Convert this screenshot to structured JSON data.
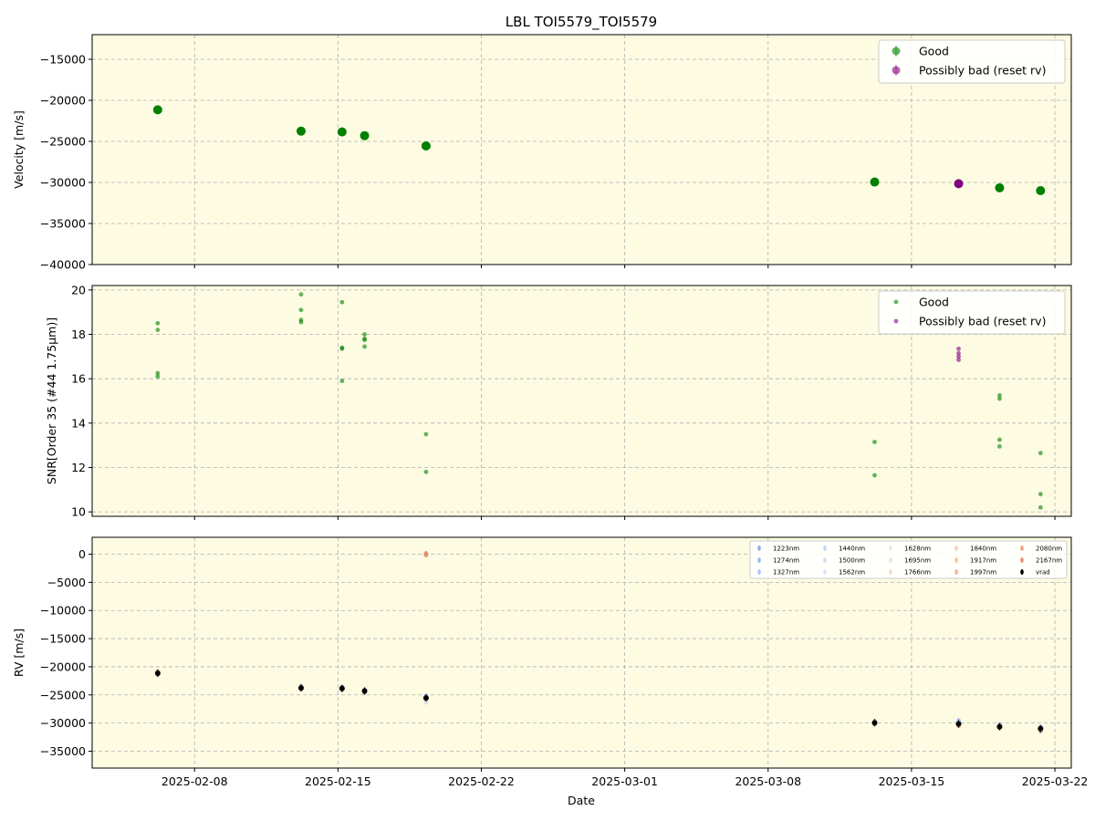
{
  "title": "LBL TOI5579_TOI5579",
  "colors": {
    "panel_bg": "#fdfbe2",
    "good": "#008000",
    "bad": "#800080",
    "vrad": "#000000"
  },
  "chart_data": [
    {
      "type": "scatter",
      "ylabel": "Velocity [m/s]",
      "ylim": [
        -40000,
        -12000
      ],
      "yticks": [
        -40000,
        -35000,
        -30000,
        -25000,
        -20000,
        -15000
      ],
      "xlim": [
        "2025-02-03",
        "2025-03-22.8"
      ],
      "xticks": [
        "2025-02-08",
        "2025-02-15",
        "2025-02-22",
        "2025-03-01",
        "2025-03-08",
        "2025-03-15",
        "2025-03-22"
      ],
      "grid": true,
      "legend": "top-right",
      "series": [
        {
          "name": "Good",
          "points": [
            {
              "x": "2025-02-06.2",
              "y": -21150
            },
            {
              "x": "2025-02-13.2",
              "y": -23750
            },
            {
              "x": "2025-02-15.2",
              "y": -23850
            },
            {
              "x": "2025-02-16.3",
              "y": -24300
            },
            {
              "x": "2025-02-19.3",
              "y": -25550
            },
            {
              "x": "2025-03-13.2",
              "y": -29950
            },
            {
              "x": "2025-03-19.3",
              "y": -30650
            },
            {
              "x": "2025-03-21.3",
              "y": -31000
            }
          ]
        },
        {
          "name": "Possibly bad (reset rv)",
          "points": [
            {
              "x": "2025-03-17.3",
              "y": -30150
            }
          ]
        }
      ]
    },
    {
      "type": "scatter",
      "ylabel": "SNR[Order 35 (#44 1.75μm)]",
      "ylim": [
        9.8,
        20.2
      ],
      "yticks": [
        10,
        12,
        14,
        16,
        18,
        20
      ],
      "xlim": [
        "2025-02-03",
        "2025-03-22.8"
      ],
      "grid": true,
      "legend": "top-right",
      "series": [
        {
          "name": "Good",
          "points": [
            {
              "x": "2025-02-06.2",
              "y": 18.5
            },
            {
              "x": "2025-02-06.2",
              "y": 18.2
            },
            {
              "x": "2025-02-06.2",
              "y": 16.25
            },
            {
              "x": "2025-02-06.2",
              "y": 16.1
            },
            {
              "x": "2025-02-13.2",
              "y": 19.8
            },
            {
              "x": "2025-02-13.2",
              "y": 19.1
            },
            {
              "x": "2025-02-13.2",
              "y": 18.65
            },
            {
              "x": "2025-02-13.2",
              "y": 18.55
            },
            {
              "x": "2025-02-15.2",
              "y": 19.45
            },
            {
              "x": "2025-02-15.2",
              "y": 17.4
            },
            {
              "x": "2025-02-15.2",
              "y": 17.35
            },
            {
              "x": "2025-02-15.2",
              "y": 15.9
            },
            {
              "x": "2025-02-16.3",
              "y": 18.0
            },
            {
              "x": "2025-02-16.3",
              "y": 17.8
            },
            {
              "x": "2025-02-16.3",
              "y": 17.75
            },
            {
              "x": "2025-02-16.3",
              "y": 17.45
            },
            {
              "x": "2025-02-19.3",
              "y": 13.5
            },
            {
              "x": "2025-02-19.3",
              "y": 11.8
            },
            {
              "x": "2025-03-13.2",
              "y": 13.15
            },
            {
              "x": "2025-03-13.2",
              "y": 11.65
            },
            {
              "x": "2025-03-19.3",
              "y": 15.25
            },
            {
              "x": "2025-03-19.3",
              "y": 15.1
            },
            {
              "x": "2025-03-19.3",
              "y": 13.25
            },
            {
              "x": "2025-03-19.3",
              "y": 12.95
            },
            {
              "x": "2025-03-21.3",
              "y": 12.65
            },
            {
              "x": "2025-03-21.3",
              "y": 10.8
            },
            {
              "x": "2025-03-21.3",
              "y": 10.2
            }
          ]
        },
        {
          "name": "Possibly bad (reset rv)",
          "points": [
            {
              "x": "2025-03-17.3",
              "y": 17.35
            },
            {
              "x": "2025-03-17.3",
              "y": 17.15
            },
            {
              "x": "2025-03-17.3",
              "y": 17.0
            },
            {
              "x": "2025-03-17.3",
              "y": 16.85
            }
          ]
        }
      ]
    },
    {
      "type": "scatter",
      "ylabel": "RV [m/s]",
      "xlabel": "Date",
      "ylim": [
        -38000,
        3000
      ],
      "yticks": [
        -35000,
        -30000,
        -25000,
        -20000,
        -15000,
        -10000,
        -5000,
        0
      ],
      "xlim": [
        "2025-02-03",
        "2025-03-22.8"
      ],
      "xticks": [
        "2025-02-08",
        "2025-02-15",
        "2025-02-22",
        "2025-03-01",
        "2025-03-08",
        "2025-03-15",
        "2025-03-22"
      ],
      "grid": true,
      "legend": "top-right",
      "legend_series": [
        {
          "name": "1223nm",
          "color": "#6f8ff0"
        },
        {
          "name": "1274nm",
          "color": "#7f9ff5"
        },
        {
          "name": "1327nm",
          "color": "#93b2f8"
        },
        {
          "name": "1440nm",
          "color": "#a9c4fb"
        },
        {
          "name": "1500nm",
          "color": "#bdd1f8"
        },
        {
          "name": "1562nm",
          "color": "#cfdaf2"
        },
        {
          "name": "1628nm",
          "color": "#dedde0"
        },
        {
          "name": "1695nm",
          "color": "#e8d6cc"
        },
        {
          "name": "1766nm",
          "color": "#f0cdb9"
        },
        {
          "name": "1840nm",
          "color": "#f5c0a3"
        },
        {
          "name": "1917nm",
          "color": "#f5ae8a"
        },
        {
          "name": "1997nm",
          "color": "#f19a74"
        },
        {
          "name": "2080nm",
          "color": "#e8845f"
        },
        {
          "name": "2167nm",
          "color": "#dc6a4c"
        },
        {
          "name": "vrad",
          "color": "#000000"
        }
      ],
      "colored_points": [
        {
          "x": "2025-02-06.2",
          "ys": [
            -21000,
            -21300,
            -20900,
            -21200
          ]
        },
        {
          "x": "2025-02-13.2",
          "ys": [
            -23600,
            -23900,
            -23700,
            -23800
          ]
        },
        {
          "x": "2025-02-15.2",
          "ys": [
            -23700,
            -24000,
            -23800,
            -23900
          ]
        },
        {
          "x": "2025-02-16.3",
          "ys": [
            -24200,
            -24500,
            -24300,
            -24400
          ]
        },
        {
          "x": "2025-02-19.3",
          "ys": [
            -25300,
            -26200,
            -25700,
            0
          ]
        },
        {
          "x": "2025-03-13.2",
          "ys": [
            -29800,
            -30100,
            -29900,
            -30000
          ]
        },
        {
          "x": "2025-03-17.3",
          "ys": [
            -29700,
            -30400,
            -30100,
            -30300
          ]
        },
        {
          "x": "2025-03-19.3",
          "ys": [
            -30400,
            -30800,
            -30600,
            -30700
          ]
        },
        {
          "x": "2025-03-21.3",
          "ys": [
            -30800,
            -31400,
            -31000,
            -31200
          ]
        }
      ],
      "vrad_points": [
        {
          "x": "2025-02-06.2",
          "y": -21150
        },
        {
          "x": "2025-02-13.2",
          "y": -23750
        },
        {
          "x": "2025-02-15.2",
          "y": -23850
        },
        {
          "x": "2025-02-16.3",
          "y": -24300
        },
        {
          "x": "2025-02-19.3",
          "y": -25550
        },
        {
          "x": "2025-03-13.2",
          "y": -29950
        },
        {
          "x": "2025-03-17.3",
          "y": -30150
        },
        {
          "x": "2025-03-19.3",
          "y": -30650
        },
        {
          "x": "2025-03-21.3",
          "y": -31000
        }
      ]
    }
  ]
}
